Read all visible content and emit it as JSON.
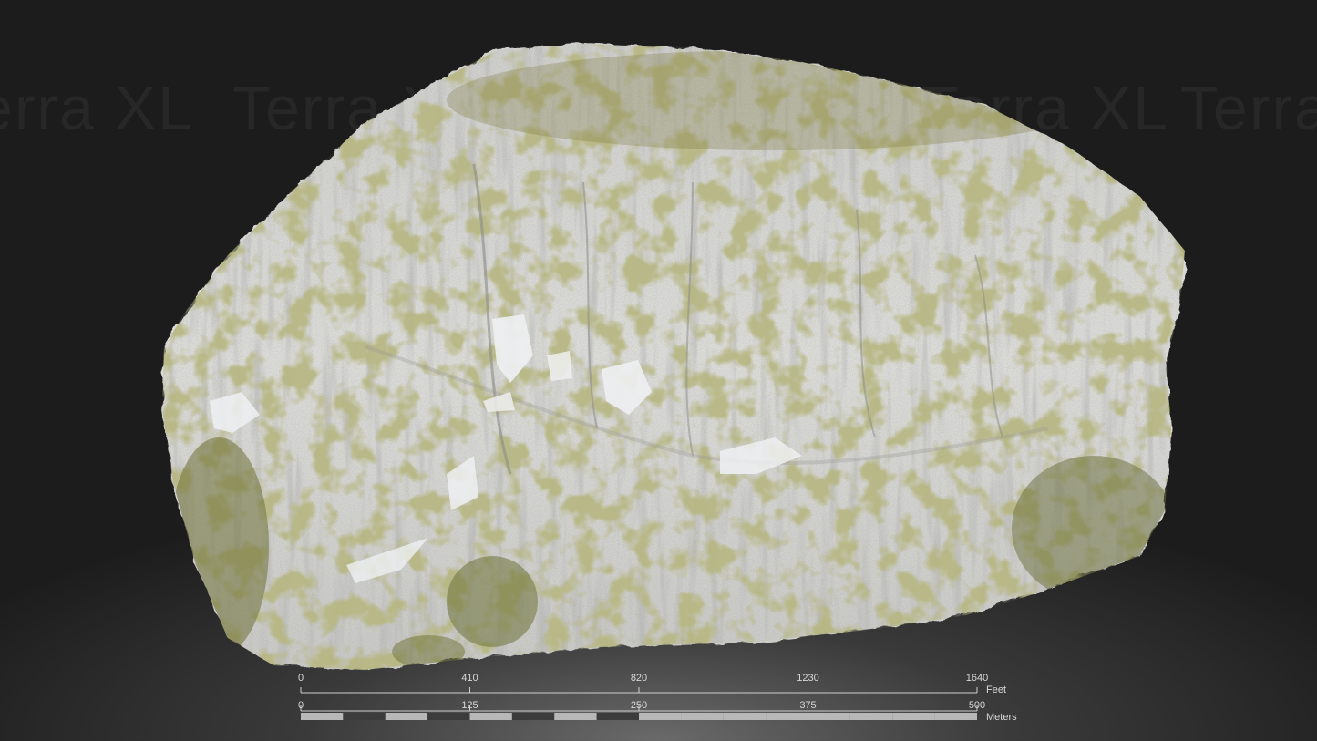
{
  "watermark": {
    "text": "Terra XL"
  },
  "scale_bar": {
    "feet": {
      "unit": "Feet",
      "ticks": [
        "0",
        "410",
        "820",
        "1230",
        "1640"
      ]
    },
    "meters": {
      "unit": "Meters",
      "ticks": [
        "0",
        "125",
        "250",
        "375",
        "500"
      ]
    }
  },
  "colors": {
    "background": "#1c1c1c",
    "rock": "#d6d6d4",
    "moss": "#7c7a3a",
    "scale_light": "#b8b8b8",
    "scale_dark": "#3c3c3c"
  }
}
